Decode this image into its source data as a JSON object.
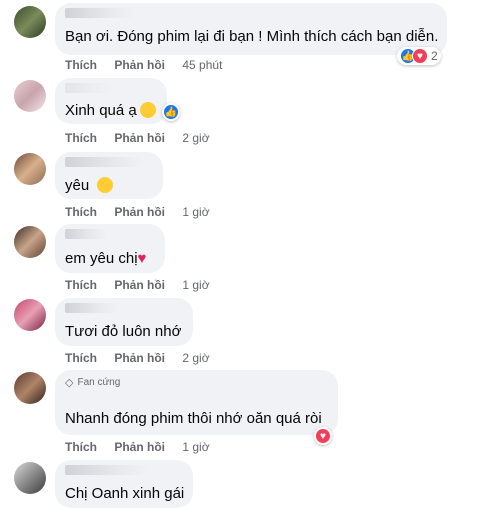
{
  "colors": {
    "link": "#65676b",
    "like": "#1877f2",
    "love": "#f33e58",
    "bubble": "#f0f2f5"
  },
  "comments": [
    {
      "text": "Bạn ơi. Đóng phim lại đi bạn ! Mình thích cách bạn diễn.",
      "like": "Thích",
      "reply": "Phản hồi",
      "time": "45 phút",
      "reaction_count": "2",
      "reactions": [
        "like-icon",
        "love-icon"
      ]
    },
    {
      "text": "Xinh quá ạ",
      "like": "Thích",
      "reply": "Phản hồi",
      "time": "2 giờ",
      "inline_emoji": "heart-eyes-emoji",
      "reactions": [
        "like-icon"
      ]
    },
    {
      "text": "yêu",
      "like": "Thích",
      "reply": "Phản hồi",
      "time": "1 giờ",
      "inline_emoji": "kissing-emoji"
    },
    {
      "text": "em yêu chị",
      "like": "Thích",
      "reply": "Phản hồi",
      "time": "1 giờ",
      "heart": "♥"
    },
    {
      "text": "Tươi đỏ luôn nhớ",
      "like": "Thích",
      "reply": "Phản hồi",
      "time": "2 giờ"
    },
    {
      "badge": "Fan cứng",
      "text": "Nhanh đóng phim thôi nhớ oăn quá ròi",
      "like": "Thích",
      "reply": "Phản hồi",
      "time": "1 giờ",
      "reactions": [
        "love-icon"
      ]
    },
    {
      "text": "Chị Oanh xinh gái"
    }
  ]
}
